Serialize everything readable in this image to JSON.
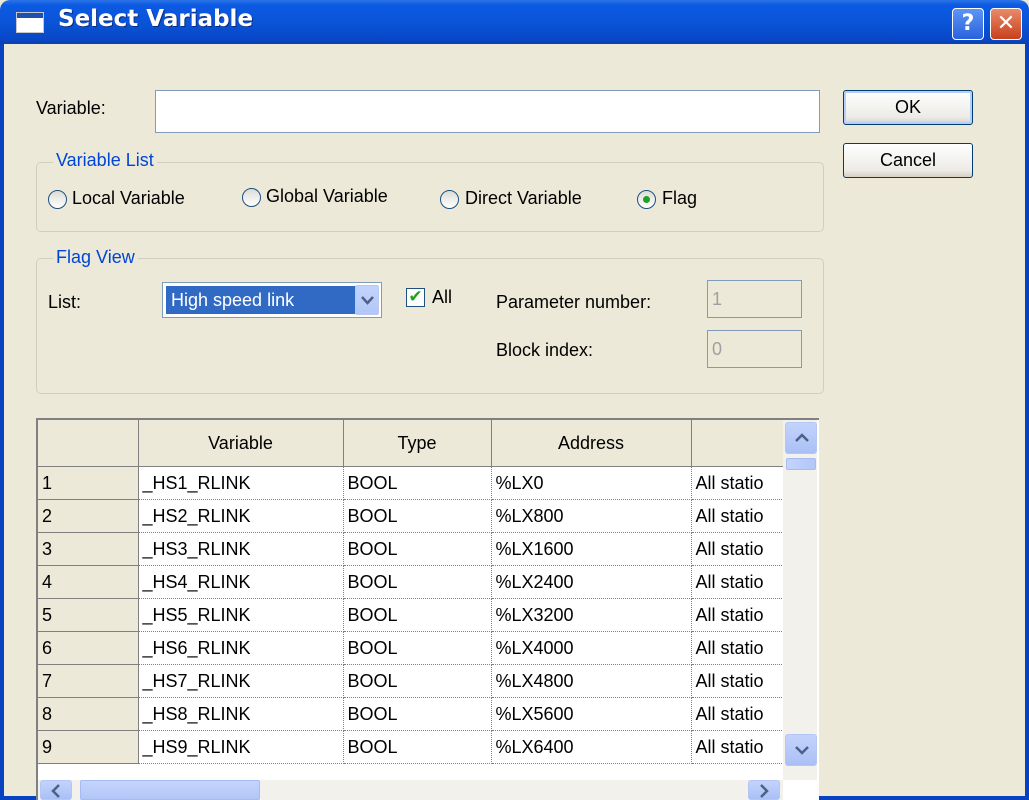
{
  "window": {
    "title": "Select Variable",
    "help_label": "?",
    "close_label": "✕"
  },
  "variable": {
    "label": "Variable:",
    "value": ""
  },
  "buttons": {
    "ok": "OK",
    "cancel": "Cancel"
  },
  "variable_list": {
    "legend": "Variable List",
    "options": [
      "Local Variable",
      "Global Variable",
      "Direct Variable",
      "Flag"
    ],
    "selected": "Flag"
  },
  "flag_view": {
    "legend": "Flag View",
    "list_label": "List:",
    "list_value": "High speed link",
    "all_label": "All",
    "all_checked": true,
    "parameter_label": "Parameter number:",
    "parameter_value": "1",
    "block_label": "Block index:",
    "block_value": "0"
  },
  "grid": {
    "columns": [
      "",
      "Variable",
      "Type",
      "Address",
      ""
    ],
    "rows": [
      [
        "1",
        "_HS1_RLINK",
        "BOOL",
        "%LX0",
        "All statio"
      ],
      [
        "2",
        "_HS2_RLINK",
        "BOOL",
        "%LX800",
        "All statio"
      ],
      [
        "3",
        "_HS3_RLINK",
        "BOOL",
        "%LX1600",
        "All statio"
      ],
      [
        "4",
        "_HS4_RLINK",
        "BOOL",
        "%LX2400",
        "All statio"
      ],
      [
        "5",
        "_HS5_RLINK",
        "BOOL",
        "%LX3200",
        "All statio"
      ],
      [
        "6",
        "_HS6_RLINK",
        "BOOL",
        "%LX4000",
        "All statio"
      ],
      [
        "7",
        "_HS7_RLINK",
        "BOOL",
        "%LX4800",
        "All statio"
      ],
      [
        "8",
        "_HS8_RLINK",
        "BOOL",
        "%LX5600",
        "All statio"
      ],
      [
        "9",
        "_HS9_RLINK",
        "BOOL",
        "%LX6400",
        "All statio"
      ]
    ]
  },
  "icons": [
    "window-icon",
    "scroll-up-icon",
    "scroll-down-icon",
    "scroll-left-icon",
    "scroll-right-icon",
    "dropdown-arrow-icon",
    "checkmark-icon"
  ],
  "colors": {
    "titlebar": "#0a54d8",
    "legend": "#0046d5",
    "selection": "#316ac5",
    "radio_dot": "#21a121"
  }
}
